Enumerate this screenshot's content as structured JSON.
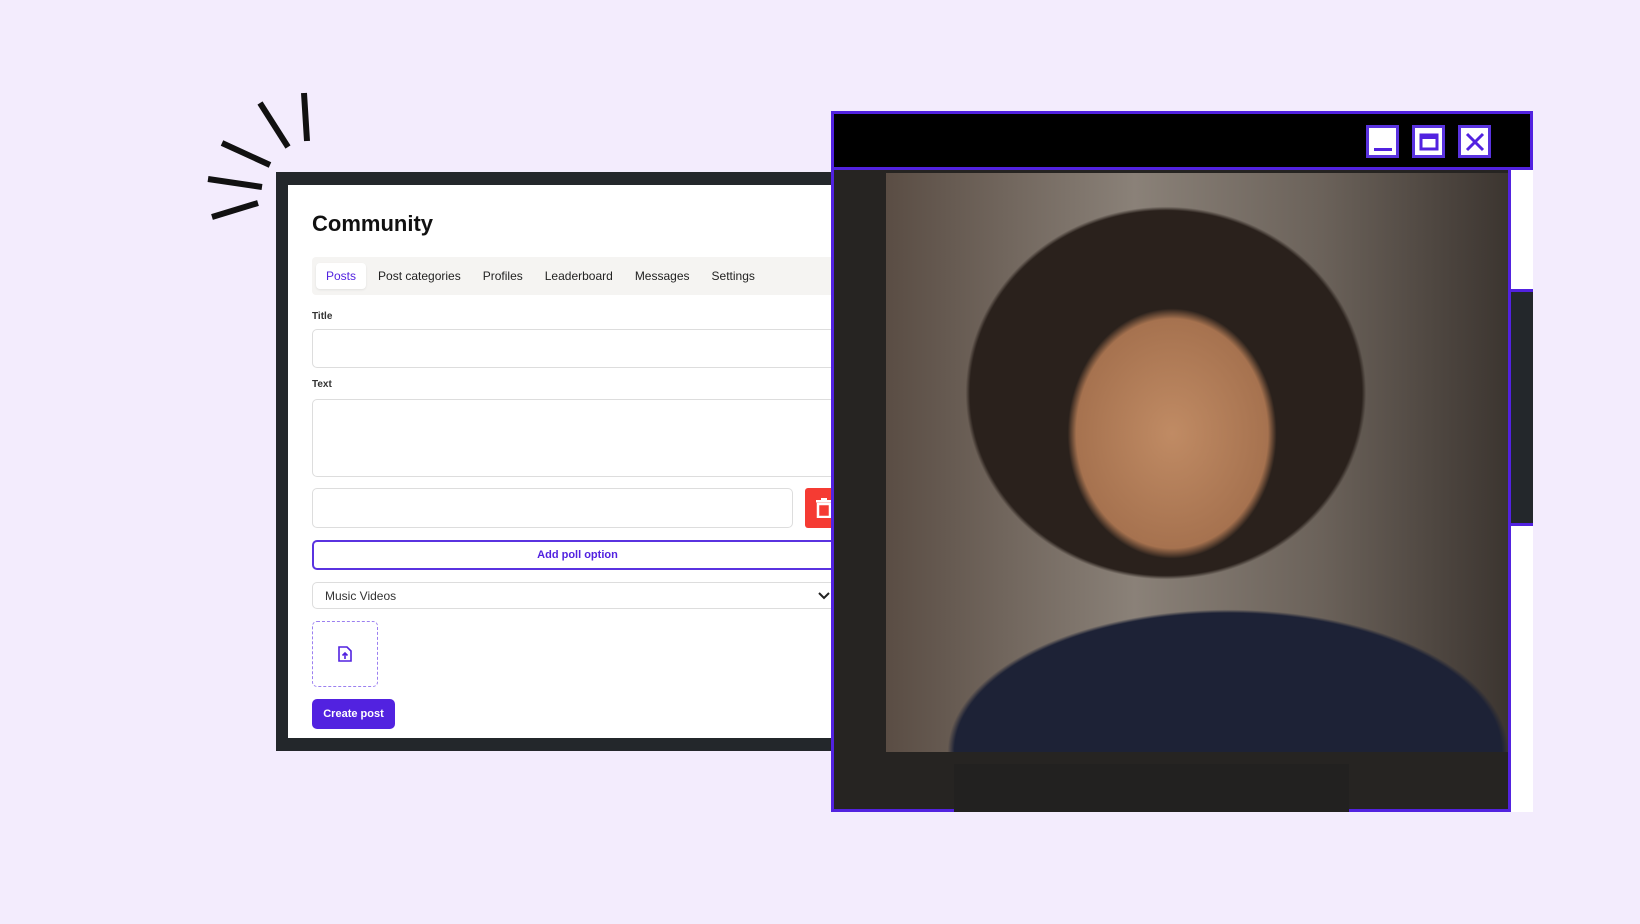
{
  "app": {
    "title": "Community"
  },
  "tabs": [
    {
      "label": "Posts",
      "active": true
    },
    {
      "label": "Post categories"
    },
    {
      "label": "Profiles"
    },
    {
      "label": "Leaderboard"
    },
    {
      "label": "Messages"
    },
    {
      "label": "Settings"
    }
  ],
  "form": {
    "title_label": "Title",
    "title_value": "",
    "text_label": "Text",
    "text_value": "",
    "poll_option_value": "",
    "add_poll_label": "Add poll option",
    "category_selected": "Music Videos",
    "create_label": "Create post"
  },
  "icons": {
    "delete": "trash-icon",
    "upload": "file-upload-icon",
    "select": "chevron-down-icon",
    "window": [
      "minimize-icon",
      "maximize-icon",
      "close-icon"
    ]
  },
  "colors": {
    "accent": "#5222e0",
    "danger": "#f53b33",
    "background": "#f3ecfd"
  }
}
